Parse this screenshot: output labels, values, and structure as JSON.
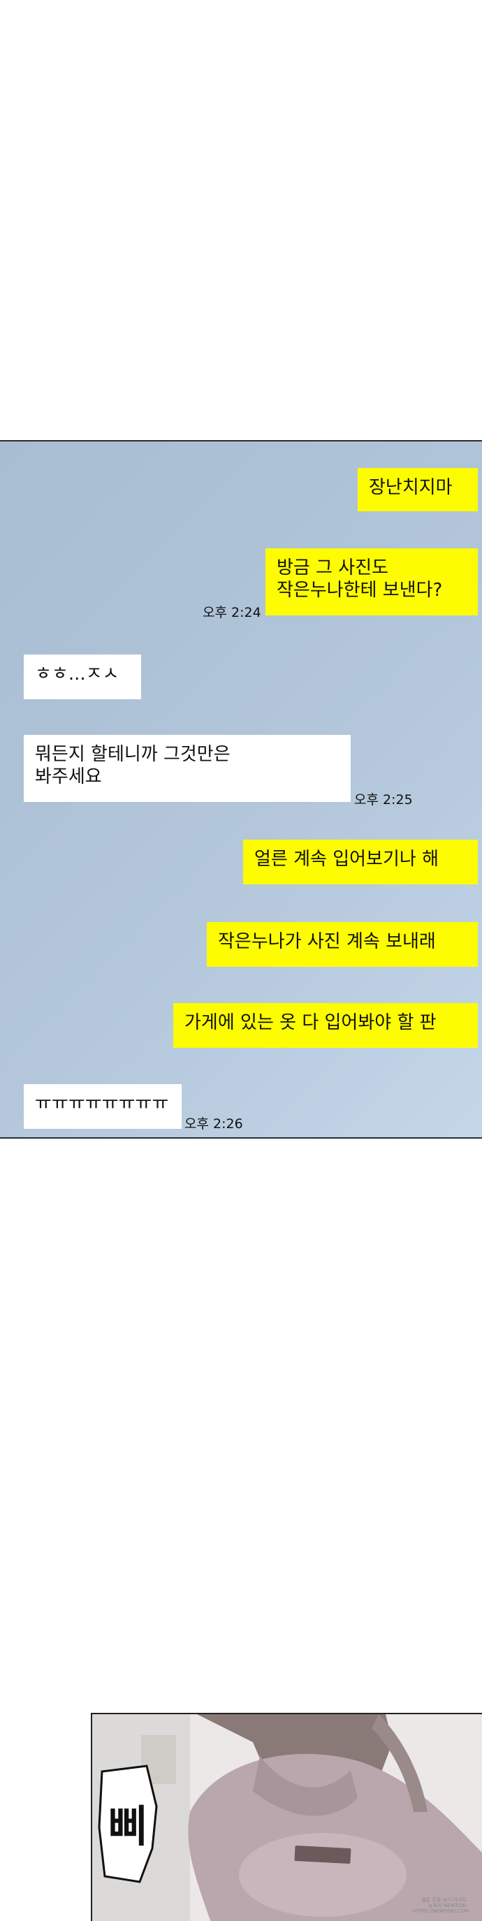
{
  "chat": {
    "messages": [
      {
        "text": "장난치지마"
      },
      {
        "text": "방금 그 사진도\n작은누나한테 보낸다?",
        "time": "오후 2:24"
      },
      {
        "text": "ㅎㅎ...ㅈㅅ"
      },
      {
        "text": "뭐든지 할테니까 그것만은\n봐주세요",
        "time": "오후 2:25"
      },
      {
        "text": "얼른 계속 입어보기나 해"
      },
      {
        "text": "작은누나가 사진 계속 보내래"
      },
      {
        "text": "가게에 있는 옷 다 입어봐야 할 판"
      },
      {
        "text": "ㅠㅠㅠㅠㅠㅠㅠㅠ",
        "time": "오후 2:26"
      }
    ],
    "colors": {
      "sent": "#fdfc00",
      "received": "#ffffff",
      "background": "#b3c6da"
    }
  },
  "comic": {
    "sfx": "삐",
    "watermark": "웹툰 무료 보기 사이트\n뉴토끼 NEWTOKI\nHTTPS://NEWTOKI.COM"
  }
}
